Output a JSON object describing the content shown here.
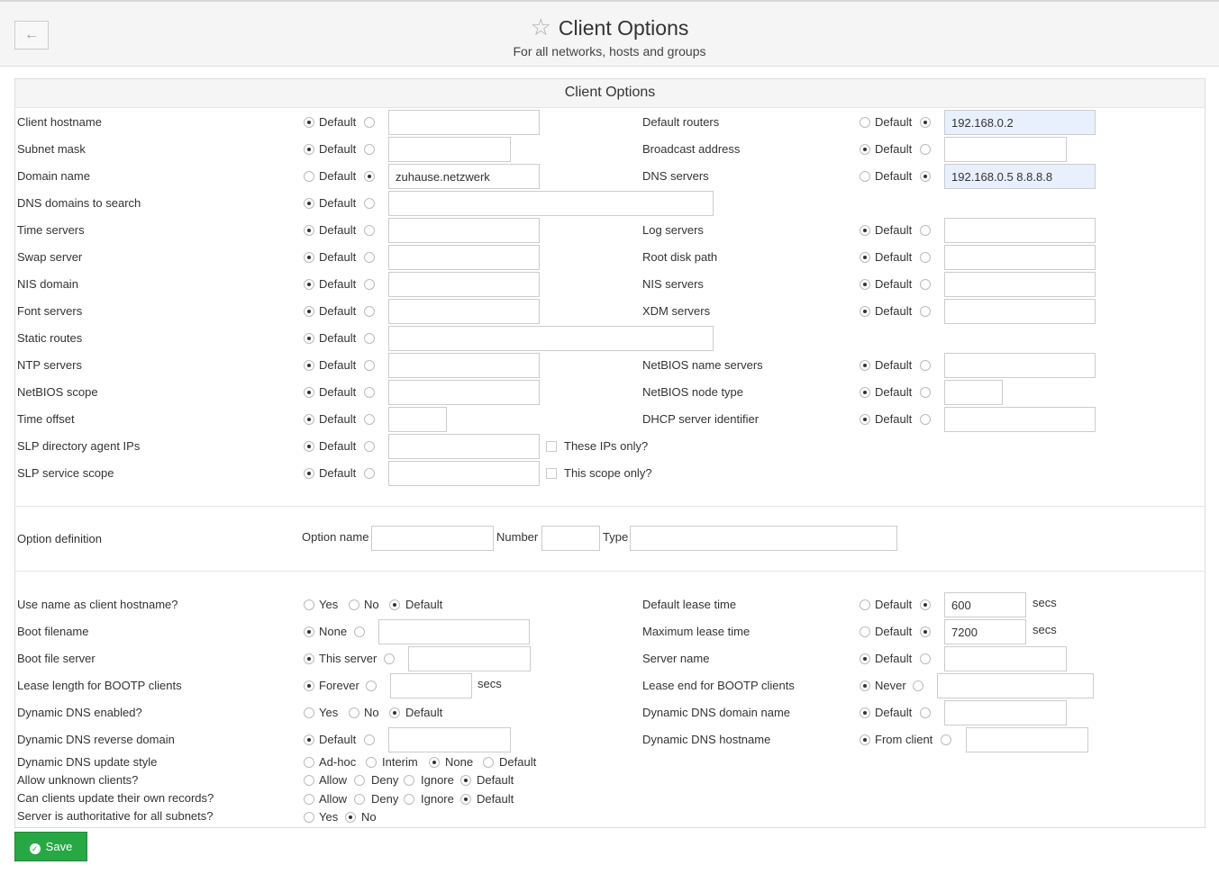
{
  "header": {
    "back_icon": "←",
    "title": "Client Options",
    "subtitle": "For all networks, hosts and groups",
    "star_icon": "☆"
  },
  "panel": {
    "title": "Client Options"
  },
  "common": {
    "default": "Default",
    "secs": "secs",
    "yes": "Yes",
    "no": "No",
    "allow": "Allow",
    "deny": "Deny",
    "ignore": "Ignore"
  },
  "fields": {
    "client_hostname": {
      "label": "Client hostname",
      "value": ""
    },
    "default_routers": {
      "label": "Default routers",
      "value": "192.168.0.2"
    },
    "subnet_mask": {
      "label": "Subnet mask",
      "value": ""
    },
    "broadcast_address": {
      "label": "Broadcast address",
      "value": ""
    },
    "domain_name": {
      "label": "Domain name",
      "value": "zuhause.netzwerk"
    },
    "dns_servers": {
      "label": "DNS servers",
      "value": "192.168.0.5 8.8.8.8"
    },
    "dns_domains_search": {
      "label": "DNS domains to search",
      "value": ""
    },
    "time_servers": {
      "label": "Time servers",
      "value": ""
    },
    "log_servers": {
      "label": "Log servers",
      "value": ""
    },
    "swap_server": {
      "label": "Swap server",
      "value": ""
    },
    "root_disk_path": {
      "label": "Root disk path",
      "value": ""
    },
    "nis_domain": {
      "label": "NIS domain",
      "value": ""
    },
    "nis_servers": {
      "label": "NIS servers",
      "value": ""
    },
    "font_servers": {
      "label": "Font servers",
      "value": ""
    },
    "xdm_servers": {
      "label": "XDM servers",
      "value": ""
    },
    "static_routes": {
      "label": "Static routes",
      "value": ""
    },
    "ntp_servers": {
      "label": "NTP servers",
      "value": ""
    },
    "netbios_name_servers": {
      "label": "NetBIOS name servers",
      "value": ""
    },
    "netbios_scope": {
      "label": "NetBIOS scope",
      "value": ""
    },
    "netbios_node_type": {
      "label": "NetBIOS node type",
      "value": ""
    },
    "time_offset": {
      "label": "Time offset",
      "value": ""
    },
    "dhcp_server_identifier": {
      "label": "DHCP server identifier",
      "value": ""
    },
    "slp_directory_agent_ips": {
      "label": "SLP directory agent IPs",
      "value": "",
      "checkbox": "These IPs only?"
    },
    "slp_service_scope": {
      "label": "SLP service scope",
      "value": "",
      "checkbox": "This scope only?"
    }
  },
  "option_definition": {
    "label": "Option definition",
    "option_name": "Option name",
    "number": "Number",
    "type": "Type"
  },
  "lower": {
    "use_name_hostname": {
      "label": "Use name as client hostname?"
    },
    "default_lease_time": {
      "label": "Default lease time",
      "value": "600"
    },
    "boot_filename": {
      "label": "Boot filename",
      "option": "None",
      "value": ""
    },
    "max_lease_time": {
      "label": "Maximum lease time",
      "value": "7200"
    },
    "boot_file_server": {
      "label": "Boot file server",
      "option": "This server",
      "value": ""
    },
    "server_name": {
      "label": "Server name",
      "value": ""
    },
    "lease_length_bootp": {
      "label": "Lease length for BOOTP clients",
      "option": "Forever",
      "value": ""
    },
    "lease_end_bootp": {
      "label": "Lease end for BOOTP clients",
      "option": "Never",
      "value": ""
    },
    "ddns_enabled": {
      "label": "Dynamic DNS enabled?"
    },
    "ddns_domain_name": {
      "label": "Dynamic DNS domain name",
      "value": ""
    },
    "ddns_reverse_domain": {
      "label": "Dynamic DNS reverse domain",
      "value": ""
    },
    "ddns_hostname": {
      "label": "Dynamic DNS hostname",
      "option": "From client",
      "value": ""
    },
    "ddns_update_style": {
      "label": "Dynamic DNS update style",
      "opt1": "Ad-hoc",
      "opt2": "Interim",
      "opt3": "None",
      "opt4": "Default"
    },
    "allow_unknown": {
      "label": "Allow unknown clients?"
    },
    "clients_update": {
      "label": "Can clients update their own records?"
    },
    "authoritative": {
      "label": "Server is authoritative for all subnets?"
    }
  },
  "save_label": "Save"
}
